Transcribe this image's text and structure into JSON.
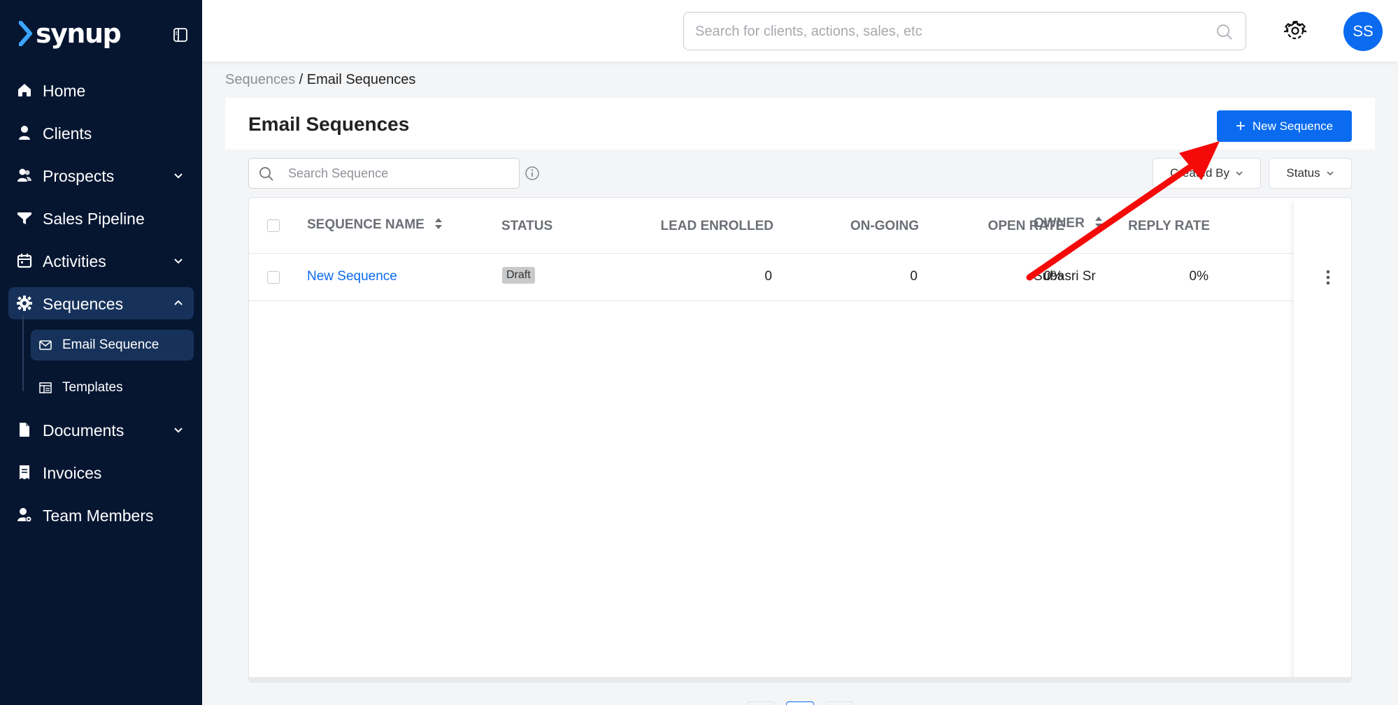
{
  "app": {
    "logo_text": "synup"
  },
  "sidebar": {
    "items": [
      {
        "label": "Home",
        "icon": "home-icon"
      },
      {
        "label": "Clients",
        "icon": "person-icon"
      },
      {
        "label": "Prospects",
        "icon": "people-icon",
        "expandable": true
      },
      {
        "label": "Sales Pipeline",
        "icon": "filter-icon"
      },
      {
        "label": "Activities",
        "icon": "calendar-icon",
        "expandable": true
      },
      {
        "label": "Sequences",
        "icon": "gear-icon",
        "expandable": true,
        "expanded": true,
        "active": true
      },
      {
        "label": "Documents",
        "icon": "document-icon",
        "expandable": true
      },
      {
        "label": "Invoices",
        "icon": "invoice-icon"
      },
      {
        "label": "Team Members",
        "icon": "team-members-icon"
      }
    ],
    "sequences_sub": [
      {
        "label": "Email Sequence",
        "icon": "mail-icon",
        "active": true
      },
      {
        "label": "Templates",
        "icon": "template-icon"
      }
    ]
  },
  "header": {
    "search_placeholder": "Search for clients, actions, sales, etc",
    "avatar_initials": "SS"
  },
  "breadcrumb": {
    "parent": "Sequences",
    "separator": "/",
    "current": "Email Sequences"
  },
  "main": {
    "title": "Email Sequences",
    "new_button_label": "New Sequence",
    "search_placeholder": "Search Sequence",
    "filters": {
      "created_by": "Created By",
      "status": "Status"
    },
    "columns": [
      "SEQUENCE NAME",
      "STATUS",
      "LEAD ENROLLED",
      "ON-GOING",
      "OPEN RATE",
      "REPLY RATE",
      "OWNER"
    ],
    "rows": [
      {
        "name": "New Sequence",
        "status": "Draft",
        "lead_enrolled": "0",
        "on_going": "0",
        "open_rate": "0%",
        "reply_rate": "0%",
        "owner": "Subasri Sr"
      }
    ]
  },
  "colors": {
    "sidebar_bg": "#061631",
    "sidebar_active": "#17325a",
    "primary": "#0a6bf0",
    "annotation_arrow": "#ff0000"
  }
}
